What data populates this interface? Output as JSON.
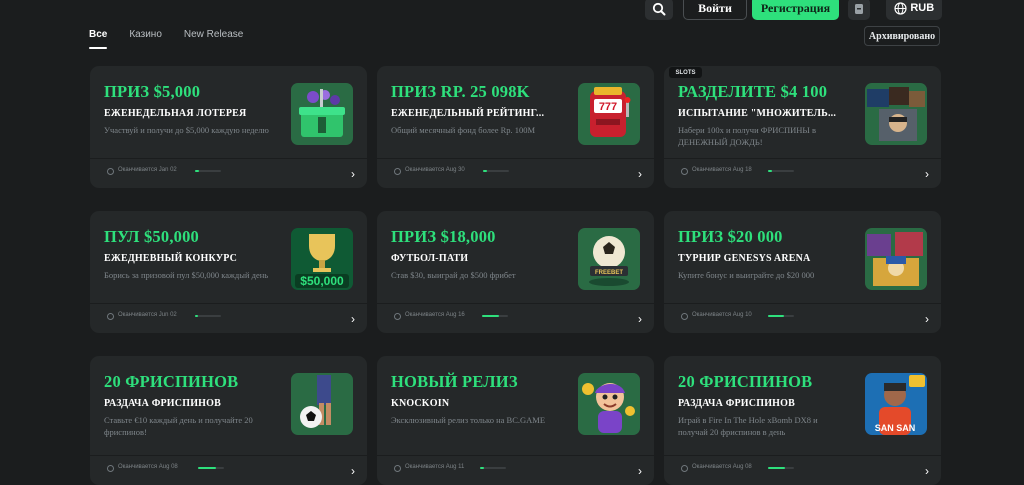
{
  "header": {
    "login_label": "Войти",
    "register_label": "Регистрация",
    "currency_code": "RUB",
    "icons": [
      "search-icon",
      "wallet-icon",
      "globe-icon"
    ]
  },
  "tabs": [
    {
      "label": "Все",
      "active": true
    },
    {
      "label": "Казино",
      "active": false
    },
    {
      "label": "New Release",
      "active": false
    }
  ],
  "archive_label": "Архивировано",
  "accent_color": "#2ee07c",
  "slots_badge": "SLOTS",
  "cards": [
    {
      "title": "ПРИЗ $5,000",
      "subtitle": "ЕЖЕНЕДЕЛЬНАЯ ЛОТЕРЕЯ",
      "description": "Участвуй и получи до $5,000 каждую неделю",
      "ends": "Оканчивается Jan 02",
      "progress": 0.15,
      "image": "lottery-box-icon"
    },
    {
      "title": "ПРИЗ RP. 25 098K",
      "subtitle": "ЕЖЕНЕДЕЛЬНЫЙ РЕЙТИНГ...",
      "description": "Общий месячный фонд более Rp. 100M",
      "ends": "Оканчивается Aug 30",
      "progress": 0.15,
      "image": "slot-machine-icon"
    },
    {
      "title": "РАЗДЕЛИТЕ $4 100",
      "subtitle": "ИСПЫТАНИЕ \"МНОЖИТЕЛЬ...",
      "description": "Набери 100x и получи ФРИСПИНЫ в ДЕНЕЖНЫЙ ДОЖДЬ!",
      "ends": "Оканчивается Aug 18",
      "progress": 0.15,
      "image": "game-collage-icon"
    },
    {
      "title": "ПУЛ $50,000",
      "subtitle": "ЕЖЕДНЕВНЫЙ КОНКУРС",
      "description": "Борись за призовой пул $50,000 каждый день",
      "ends": "Оканчивается Jun 02",
      "progress": 0.1,
      "image": "trophy-icon"
    },
    {
      "title": "ПРИЗ $18,000",
      "subtitle": "ФУТБОЛ-ПАТИ",
      "description": "Став $30, выиграй до $500 фрибет",
      "ends": "Оканчивается Aug 16",
      "progress": 0.65,
      "image": "football-icon"
    },
    {
      "title": "ПРИЗ $20 000",
      "subtitle": "ТУРНИР GENESYS ARENA",
      "description": "Купите бонус и выиграйте до $20 000",
      "ends": "Оканчивается Aug 10",
      "progress": 0.6,
      "image": "pharaoh-icon"
    },
    {
      "title": "20 ФРИСПИНОВ",
      "subtitle": "РАЗДАЧА ФРИСПИНОВ",
      "description": "Ставьте €10 каждый день и получайте 20 фриспинов!",
      "ends": "Оканчивается Aug 08",
      "progress": 0.7,
      "image": "soccer-player-icon"
    },
    {
      "title": "НОВЫЙ РЕЛИЗ",
      "subtitle": "KNOCKOIN",
      "description": "Эксклюзивный релиз только на BC.GAME",
      "ends": "Оканчивается Aug 11",
      "progress": 0.15,
      "image": "cartoon-boy-icon"
    },
    {
      "title": "20 ФРИСПИНОВ",
      "subtitle": "РАЗДАЧА ФРИСПИНОВ",
      "description": "Играй в Fire In The Hole xBomb DX8 и получай 20 фриспинов в день",
      "ends": "Оканчивается Aug 08",
      "progress": 0.65,
      "image": "san-san-icon"
    }
  ]
}
